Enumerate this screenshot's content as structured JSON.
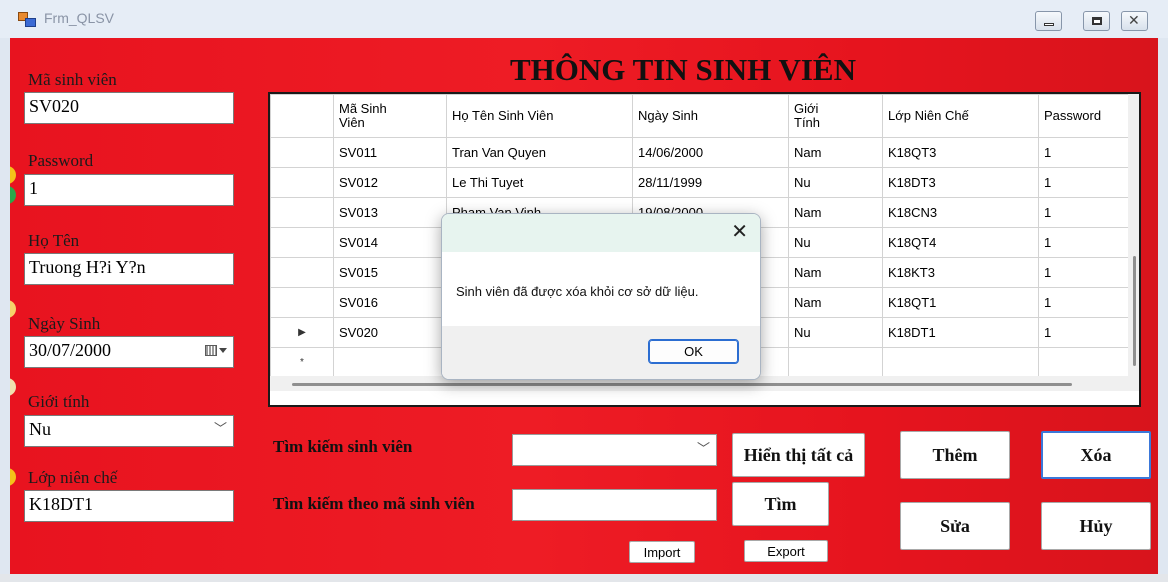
{
  "window": {
    "title": "Frm_QLSV"
  },
  "form": {
    "heading": "THÔNG TIN SINH VIÊN",
    "fields": {
      "ma_sinh_vien": {
        "label": "Mã sinh viên",
        "value": "SV020"
      },
      "password": {
        "label": "Password",
        "value": "1"
      },
      "ho_ten": {
        "label": "Họ Tên",
        "value": "Truong H?i Y?n"
      },
      "ngay_sinh": {
        "label": "Ngày Sinh",
        "value": "30/07/2000"
      },
      "gioi_tinh": {
        "label": "Giới tính",
        "value": "Nu"
      },
      "lop_nien_che": {
        "label": "Lớp niên chế",
        "value": "K18DT1"
      }
    }
  },
  "grid": {
    "columns": [
      "Mã Sinh\nViên",
      "Họ Tên Sinh Viên",
      "Ngày Sinh",
      "Giới\nTính",
      "Lớp Niên Chế",
      "Password"
    ],
    "rows": [
      [
        "SV011",
        "Tran Van Quyen",
        "14/06/2000",
        "Nam",
        "K18QT3",
        "1"
      ],
      [
        "SV012",
        "Le Thi Tuyet",
        "28/11/1999",
        "Nu",
        "K18DT3",
        "1"
      ],
      [
        "SV013",
        "Pham Van Vinh",
        "19/08/2000",
        "Nam",
        "K18CN3",
        "1"
      ],
      [
        "SV014",
        "",
        "",
        "Nu",
        "K18QT4",
        "1"
      ],
      [
        "SV015",
        "",
        "",
        "Nam",
        "K18KT3",
        "1"
      ],
      [
        "SV016",
        "",
        "",
        "Nam",
        "K18QT1",
        "1"
      ],
      [
        "SV020",
        "",
        "",
        "Nu",
        "K18DT1",
        "1"
      ],
      [
        "",
        "",
        "",
        "",
        "",
        ""
      ]
    ],
    "row_markers": [
      "",
      "",
      "",
      "",
      "",
      "",
      "▶",
      "*"
    ]
  },
  "search": {
    "label_search": "Tìm kiếm sinh viên",
    "label_by_id": "Tìm kiếm theo mã sinh viên",
    "combo_value": "",
    "id_value": ""
  },
  "buttons": {
    "show_all": "Hiển thị tất cả",
    "find": "Tìm",
    "import": "Import",
    "export": "Export",
    "add": "Thêm",
    "delete": "Xóa",
    "edit": "Sửa",
    "cancel": "Hủy"
  },
  "dialog": {
    "message": "Sinh viên đã được xóa khỏi cơ sở dữ liệu.",
    "ok": "OK",
    "close_glyph": "✕"
  }
}
